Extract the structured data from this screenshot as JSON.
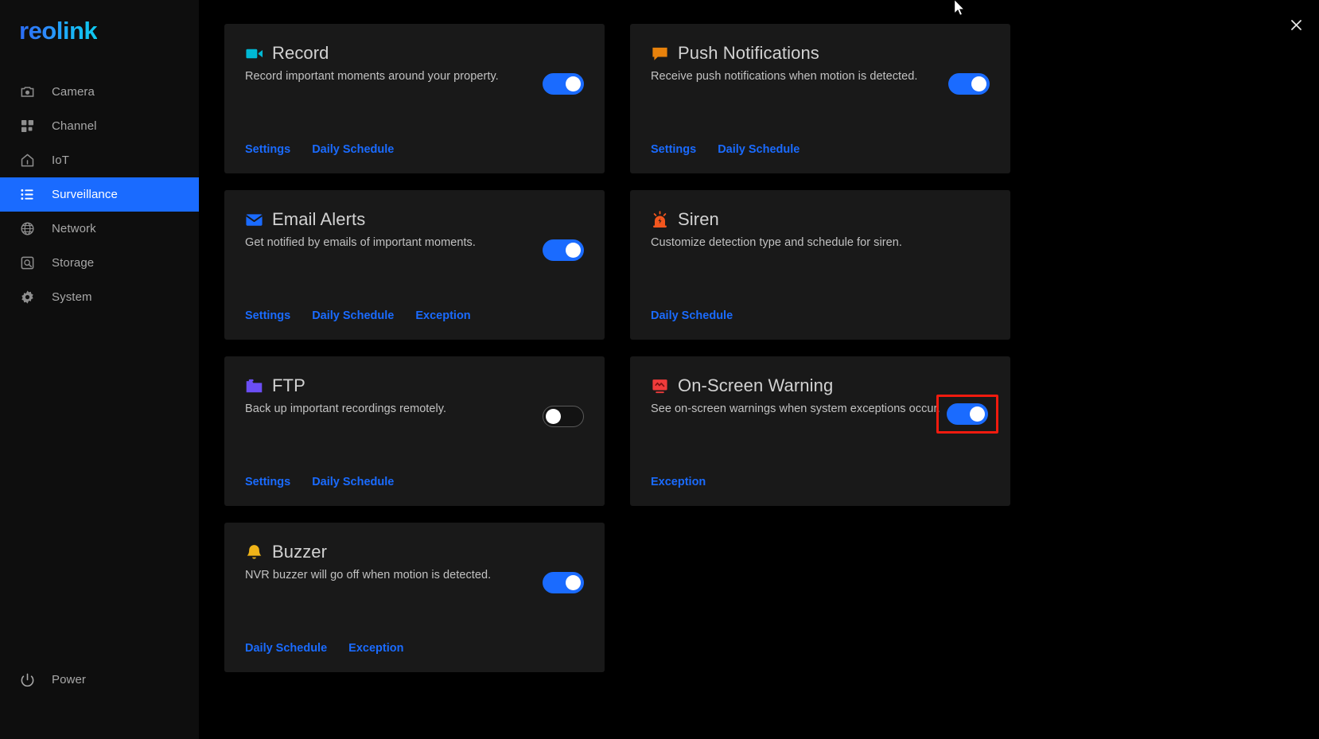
{
  "brand": {
    "logo_text": "reolink",
    "logo_color": "#1a8cff"
  },
  "sidebar": {
    "items": [
      {
        "label": "Camera",
        "icon": "camera-icon",
        "active": false
      },
      {
        "label": "Channel",
        "icon": "grid-icon",
        "active": false
      },
      {
        "label": "IoT",
        "icon": "home-icon",
        "active": false
      },
      {
        "label": "Surveillance",
        "icon": "list-icon",
        "active": true
      },
      {
        "label": "Network",
        "icon": "globe-icon",
        "active": false
      },
      {
        "label": "Storage",
        "icon": "hard-drive-icon",
        "active": false
      },
      {
        "label": "System",
        "icon": "gear-icon",
        "active": false
      }
    ],
    "power": {
      "label": "Power",
      "icon": "power-icon"
    },
    "active_color": "#1a6bff"
  },
  "window": {
    "close_icon": "close-icon"
  },
  "cards": [
    {
      "title": "Record",
      "desc": "Record important moments around your property.",
      "icon": "video-camera-icon",
      "icon_color": "#00b8d4",
      "toggle": {
        "state": "on",
        "highlighted": false
      },
      "links": [
        "Settings",
        "Daily Schedule"
      ]
    },
    {
      "title": "Push Notifications",
      "desc": "Receive push notifications when motion is detected.",
      "icon": "speech-bubble-icon",
      "icon_color": "#e8820c",
      "toggle": {
        "state": "on",
        "highlighted": false
      },
      "links": [
        "Settings",
        "Daily Schedule"
      ]
    },
    {
      "title": "Email Alerts",
      "desc": "Get notified by emails of important moments.",
      "icon": "envelope-icon",
      "icon_color": "#1a6bff",
      "toggle": {
        "state": "on",
        "highlighted": false
      },
      "links": [
        "Settings",
        "Daily Schedule",
        "Exception"
      ]
    },
    {
      "title": "Siren",
      "desc": "Customize detection type and schedule for siren.",
      "icon": "siren-icon",
      "icon_color": "#f2561e",
      "toggle": null,
      "links": [
        "Daily Schedule"
      ]
    },
    {
      "title": "FTP",
      "desc": "Back up important recordings remotely.",
      "icon": "folder-icon",
      "icon_color": "#6b4ef5",
      "toggle": {
        "state": "off",
        "highlighted": false
      },
      "links": [
        "Settings",
        "Daily Schedule"
      ]
    },
    {
      "title": "On-Screen Warning",
      "desc": "See on-screen warnings when system exceptions occur.",
      "icon": "monitor-warning-icon",
      "icon_color": "#ef3b3b",
      "toggle": {
        "state": "on",
        "highlighted": true
      },
      "links": [
        "Exception"
      ]
    },
    {
      "title": "Buzzer",
      "desc": "NVR buzzer will go off when motion is detected.",
      "icon": "bell-icon",
      "icon_color": "#f0b418",
      "toggle": {
        "state": "on",
        "highlighted": false
      },
      "links": [
        "Daily Schedule",
        "Exception"
      ]
    }
  ],
  "highlight_color": "#f21b0f"
}
